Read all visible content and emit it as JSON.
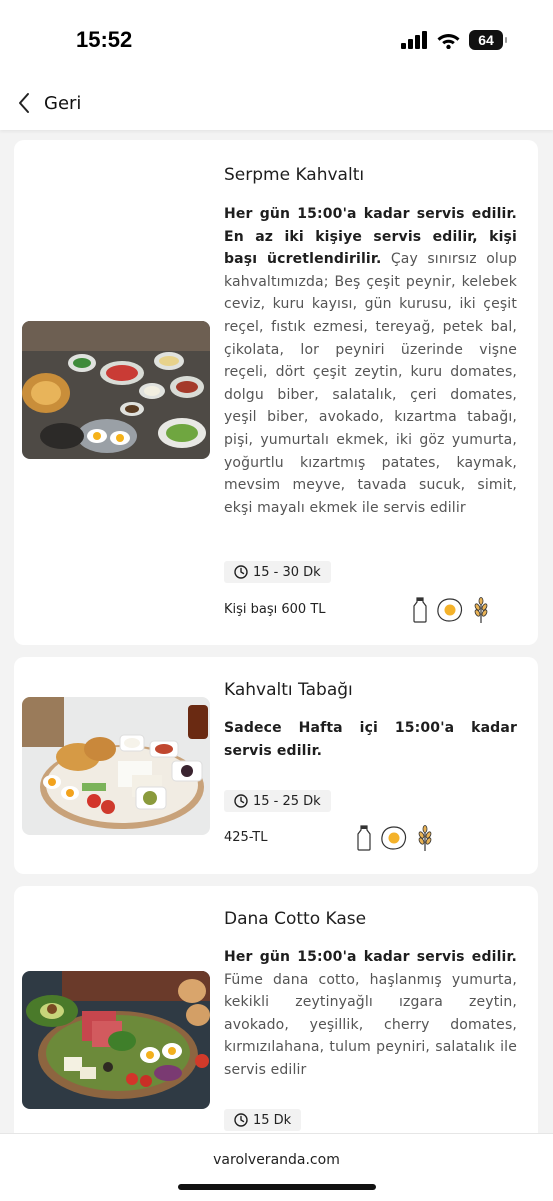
{
  "status_bar": {
    "time": "15:52",
    "battery": "64"
  },
  "nav": {
    "back_label": "Geri"
  },
  "items": [
    {
      "title": "Serpme Kahvaltı",
      "desc_bold": "Her gün 15:00'a kadar servis edilir. En az iki kişiye servis edilir, kişi başı ücretlendirilir.",
      "desc": " Çay sınırsız olup kahvaltımızda; Beş çeşit peynir, kelebek ceviz, kuru kayısı, gün kurusu, iki çeşit reçel, fıstık ezmesi, tereyağ, petek bal, çikolata, lor peyniri üzerinde vişne reçeli, dört çeşit zeytin, kuru domates, dolgu biber, salatalık, çeri domates, yeşil biber, avokado, kızartma tabağı, pişi, yumurtalı ekmek, iki göz yumurta, yoğurtlu kızartmış patates, kaymak, mevsim meyve, tavada sucuk, simit, ekşi mayalı ekmek ile servis edilir",
      "time": "15 - 30 Dk",
      "price": "Kişi başı 600 TL",
      "icons": [
        "milk-bottle-icon",
        "egg-icon",
        "wheat-icon"
      ]
    },
    {
      "title": "Kahvaltı Tabağı",
      "desc_bold": "Sadece Hafta içi 15:00'a kadar servis edilir.",
      "desc": "",
      "time": "15 - 25 Dk",
      "price": "425-TL",
      "icons": [
        "milk-bottle-icon",
        "egg-icon",
        "wheat-icon"
      ]
    },
    {
      "title": "Dana Cotto Kase",
      "desc_bold": "Her gün 15:00'a kadar servis edilir.",
      "desc": " Füme dana cotto, haşlanmış yumurta, kekikli zeytinyağlı ızgara zeytin, avokado, yeşillik, cherry domates, kırmızılahana, tulum peyniri, salatalık ile servis edilir",
      "time": "15 Dk",
      "price": "",
      "icons": []
    }
  ],
  "footer": {
    "url": "varolveranda.com"
  }
}
